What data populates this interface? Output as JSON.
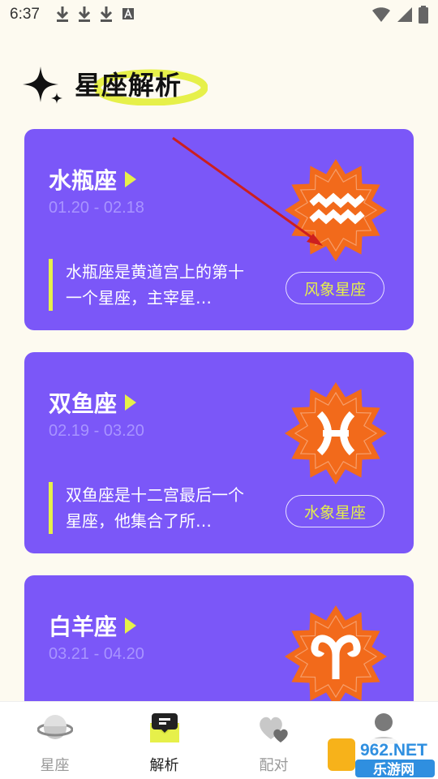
{
  "status_bar": {
    "time": "6:37",
    "left_icons": [
      "download-icon",
      "download-icon",
      "download-icon",
      "font-a-icon"
    ],
    "right_icons": [
      "wifi-icon",
      "signal-icon",
      "battery-icon"
    ]
  },
  "header": {
    "title": "星座解析",
    "icon": "sparkle-icon",
    "highlight_color": "#e6f04a"
  },
  "cards": [
    {
      "name": "水瓶座",
      "dates": "01.20 - 02.18",
      "description": "水瓶座是黄道宫上的第十一个星座，主宰星…",
      "tag": "风象星座",
      "symbol": "aquarius-symbol"
    },
    {
      "name": "双鱼座",
      "dates": "02.19 - 03.20",
      "description": "双鱼座是十二宫最后一个星座，他集合了所…",
      "tag": "水象星座",
      "symbol": "pisces-symbol"
    },
    {
      "name": "白羊座",
      "dates": "03.21 - 04.20",
      "description": "",
      "tag": "",
      "symbol": "aries-symbol"
    }
  ],
  "bottom_nav": {
    "items": [
      {
        "label": "星座",
        "icon": "planet-icon",
        "active": false
      },
      {
        "label": "解析",
        "icon": "message-icon",
        "active": true
      },
      {
        "label": "配对",
        "icon": "hearts-icon",
        "active": false
      },
      {
        "label": "",
        "icon": "user-icon",
        "active": false
      }
    ]
  },
  "watermark": {
    "text_top": "962.NET",
    "text_bottom": "乐游网"
  },
  "colors": {
    "background": "#fdfaf0",
    "card": "#7b57f8",
    "accent": "#e6f04a",
    "emblem": "#f26a1b",
    "annotation_arrow": "#cc1f1f"
  }
}
